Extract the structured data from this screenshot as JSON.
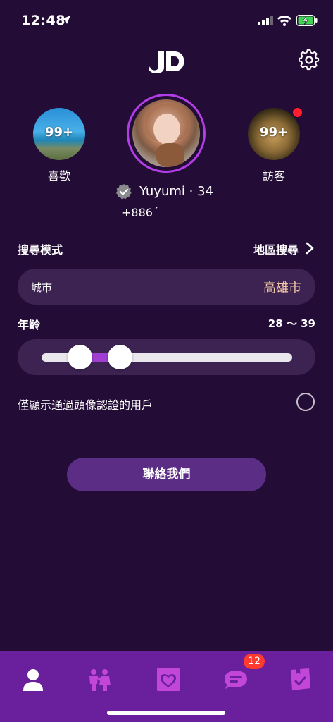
{
  "status_bar": {
    "time": "12:48",
    "icons": [
      "location-arrow-icon",
      "signal-icon",
      "wifi-icon",
      "battery-charging-icon"
    ]
  },
  "header": {
    "logo_text": "JD",
    "settings_icon": "gear-icon"
  },
  "profile": {
    "likes": {
      "count": "99+",
      "label": "喜歡"
    },
    "visitors": {
      "count": "99+",
      "label": "訪客",
      "has_notification_dot": true
    },
    "name_line": "Yuyumi · 34",
    "phone": "+886´",
    "verified_icon": "check-badge-icon"
  },
  "search": {
    "mode_label": "搜尋模式",
    "mode_value": "地區搜尋",
    "city_label": "城市",
    "city_value": "高雄市",
    "age_label": "年齡",
    "age_value": "28 ～ 39",
    "age_min": 28,
    "age_max": 39,
    "verified_only_label": "僅顯示通過頭像認證的用戶",
    "verified_only_checked": false
  },
  "contact_button": "聯絡我們",
  "bottom_nav": {
    "items": [
      "profile-icon",
      "people-icon",
      "heart-icon",
      "chat-icon",
      "tasks-icon"
    ],
    "chat_badge": "12",
    "active": "profile-icon"
  },
  "colors": {
    "background": "#230c36",
    "nav_background": "#6a1f9c",
    "accent": "#a03ed2",
    "city_value": "#f6c7a7",
    "badge": "#ff3a2f"
  }
}
